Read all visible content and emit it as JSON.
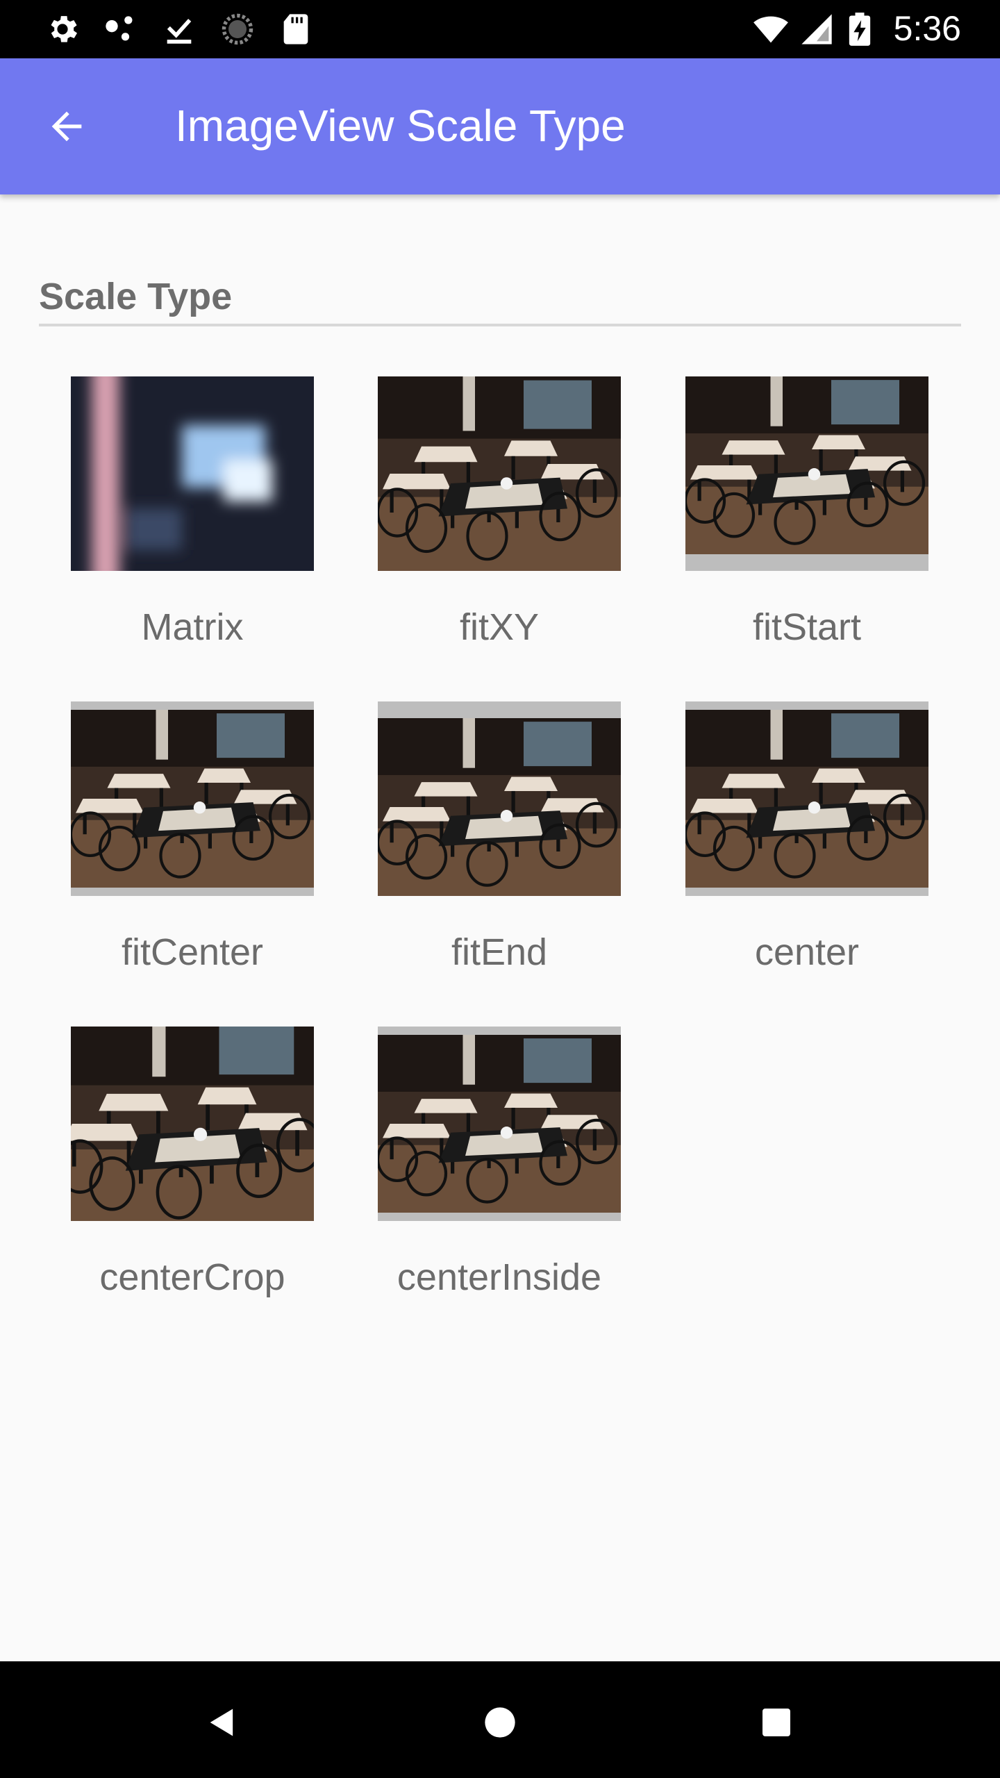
{
  "status_bar": {
    "time": "5:36",
    "left_icons": [
      "gear-icon",
      "dots-icon",
      "download-done-icon",
      "loading-circle-icon",
      "sd-card-icon"
    ],
    "right_icons": [
      "wifi-icon",
      "signal-icon",
      "battery-charging-icon"
    ]
  },
  "app_bar": {
    "title": "ImageView Scale Type",
    "back_icon": "arrow-back-icon",
    "color": "#7178f0"
  },
  "section": {
    "title": "Scale Type"
  },
  "items": [
    {
      "label": "Matrix",
      "mode": "matrix"
    },
    {
      "label": "fitXY",
      "mode": "fitXY"
    },
    {
      "label": "fitStart",
      "mode": "fitStart"
    },
    {
      "label": "fitCenter",
      "mode": "fitCenter"
    },
    {
      "label": "fitEnd",
      "mode": "fitEnd"
    },
    {
      "label": "center",
      "mode": "center"
    },
    {
      "label": "centerCrop",
      "mode": "centerCrop"
    },
    {
      "label": "centerInside",
      "mode": "centerInside"
    }
  ],
  "nav_bar": {
    "buttons": [
      "back-triangle-icon",
      "home-circle-icon",
      "recents-square-icon"
    ]
  }
}
